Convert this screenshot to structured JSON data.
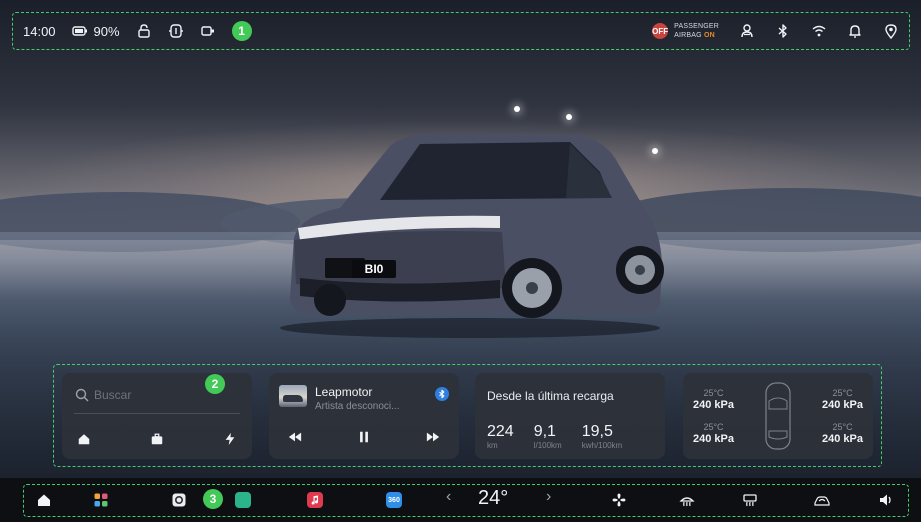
{
  "status_bar": {
    "time": "14:00",
    "battery_pct": "90%",
    "callout": "1",
    "airbag": {
      "icon_text": "OFF",
      "line1": "PASSENGER",
      "line2_prefix": "AIRBAG",
      "line2_state": "ON"
    },
    "icons_left": [
      "battery-icon",
      "lock-icon",
      "steering-wheel-icon",
      "dashcam-icon"
    ],
    "icons_right": [
      "driver-profile-icon",
      "bluetooth-icon",
      "wifi-icon",
      "bell-icon",
      "location-pin-icon"
    ]
  },
  "scene": {
    "license_plate": "BI0"
  },
  "widgets": {
    "callout": "2",
    "search": {
      "placeholder": "Buscar",
      "shortcuts": [
        "home-icon",
        "briefcase-icon",
        "lightning-icon"
      ]
    },
    "media": {
      "title": "Leapmotor",
      "artist": "Artista desconoci...",
      "controls": [
        "rewind-icon",
        "pause-icon",
        "fast-forward-icon"
      ]
    },
    "trip_stats": {
      "title": "Desde la última recarga",
      "stats": [
        {
          "value": "224",
          "unit": "km"
        },
        {
          "value": "9,1",
          "unit": "l/100km"
        },
        {
          "value": "19,5",
          "unit": "kwh/100km"
        }
      ]
    },
    "tires": {
      "front_left": {
        "temp": "25°C",
        "pressure": "240 kPa"
      },
      "front_right": {
        "temp": "25°C",
        "pressure": "240 kPa"
      },
      "rear_left": {
        "temp": "25°C",
        "pressure": "240 kPa"
      },
      "rear_right": {
        "temp": "25°C",
        "pressure": "240 kPa"
      }
    }
  },
  "dock": {
    "callout": "3",
    "temperature": "24°",
    "prev_label": "‹",
    "next_label": "›",
    "app_labels": {
      "maps": "",
      "music": "",
      "app360": "360"
    },
    "colors": {
      "music": "#e03a4e",
      "app360": "#2f8fe8",
      "maps": "#2bb38a"
    }
  },
  "colors": {
    "annotation_green": "#3fce67",
    "badge_green": "#43c957",
    "card_bg": "#2e323a"
  }
}
